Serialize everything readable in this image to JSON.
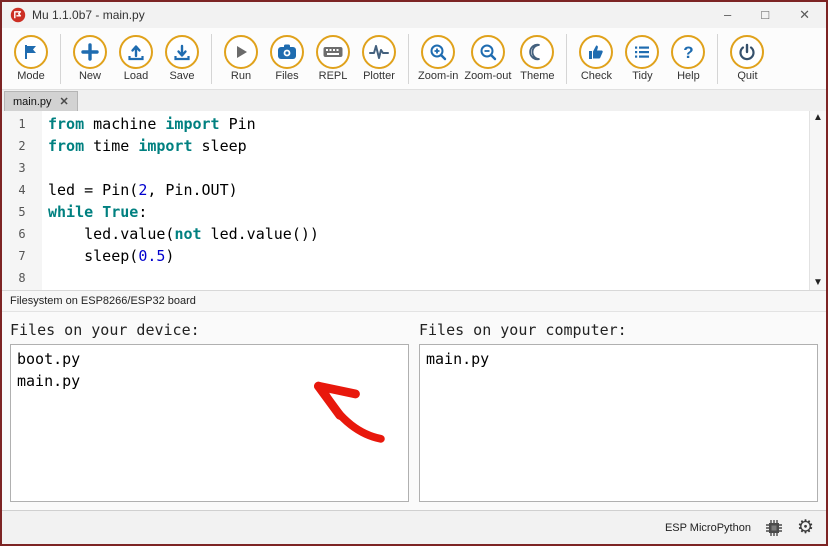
{
  "window": {
    "title": "Mu 1.1.0b7 - main.py",
    "controls": {
      "minimize": "–",
      "maximize": "□",
      "close": "✕"
    }
  },
  "toolbar": {
    "buttons": [
      {
        "label": "Mode",
        "icon": "mode-icon"
      },
      {
        "label": "New",
        "icon": "new-icon"
      },
      {
        "label": "Load",
        "icon": "load-icon"
      },
      {
        "label": "Save",
        "icon": "save-icon"
      },
      {
        "label": "Run",
        "icon": "run-icon"
      },
      {
        "label": "Files",
        "icon": "files-icon"
      },
      {
        "label": "REPL",
        "icon": "repl-icon"
      },
      {
        "label": "Plotter",
        "icon": "plotter-icon"
      },
      {
        "label": "Zoom-in",
        "icon": "zoom-in-icon"
      },
      {
        "label": "Zoom-out",
        "icon": "zoom-out-icon"
      },
      {
        "label": "Theme",
        "icon": "theme-icon"
      },
      {
        "label": "Check",
        "icon": "check-icon"
      },
      {
        "label": "Tidy",
        "icon": "tidy-icon"
      },
      {
        "label": "Help",
        "icon": "help-icon"
      },
      {
        "label": "Quit",
        "icon": "quit-icon"
      }
    ]
  },
  "tabs": [
    {
      "label": "main.py",
      "close_glyph": "✕"
    }
  ],
  "editor": {
    "scroll_up_glyph": "▲",
    "scroll_down_glyph": "▼",
    "lines": [
      {
        "n": "1",
        "segs": [
          [
            "kw",
            "from"
          ],
          [
            "pl",
            " machine "
          ],
          [
            "kw",
            "import"
          ],
          [
            "pl",
            " Pin"
          ]
        ]
      },
      {
        "n": "2",
        "segs": [
          [
            "kw",
            "from"
          ],
          [
            "pl",
            " time "
          ],
          [
            "kw",
            "import"
          ],
          [
            "pl",
            " sleep"
          ]
        ]
      },
      {
        "n": "3",
        "segs": []
      },
      {
        "n": "4",
        "segs": [
          [
            "pl",
            "led = Pin("
          ],
          [
            "num",
            "2"
          ],
          [
            "pl",
            ", Pin.OUT)"
          ]
        ]
      },
      {
        "n": "5",
        "segs": [
          [
            "kw",
            "while"
          ],
          [
            "pl",
            " "
          ],
          [
            "kw",
            "True"
          ],
          [
            "pl",
            ":"
          ]
        ]
      },
      {
        "n": "6",
        "segs": [
          [
            "pl",
            "    led.value("
          ],
          [
            "kw",
            "not"
          ],
          [
            "pl",
            " led.value())"
          ]
        ]
      },
      {
        "n": "7",
        "segs": [
          [
            "pl",
            "    sleep("
          ],
          [
            "num",
            "0.5"
          ],
          [
            "pl",
            ")"
          ]
        ]
      },
      {
        "n": "8",
        "segs": []
      }
    ]
  },
  "files": {
    "header": "Filesystem on ESP8266/ESP32 board",
    "device": {
      "title": "Files on your device:",
      "files": [
        "boot.py",
        "main.py"
      ]
    },
    "computer": {
      "title": "Files on your computer:",
      "files": [
        "main.py"
      ]
    }
  },
  "statusbar": {
    "mode": "ESP MicroPython",
    "gear_glyph": "⚙"
  },
  "annotation": {
    "type": "arrow",
    "color": "#e8180c",
    "points_to": "device-file-list"
  },
  "colors": {
    "ring_gold": "#e0a21c",
    "icon_blue": "#1f6cb0",
    "keyword_teal": "#008080",
    "number_blue": "#0000cd",
    "logo_red": "#cc2f24",
    "arrow_red": "#e8180c",
    "window_border": "#7d2424"
  }
}
